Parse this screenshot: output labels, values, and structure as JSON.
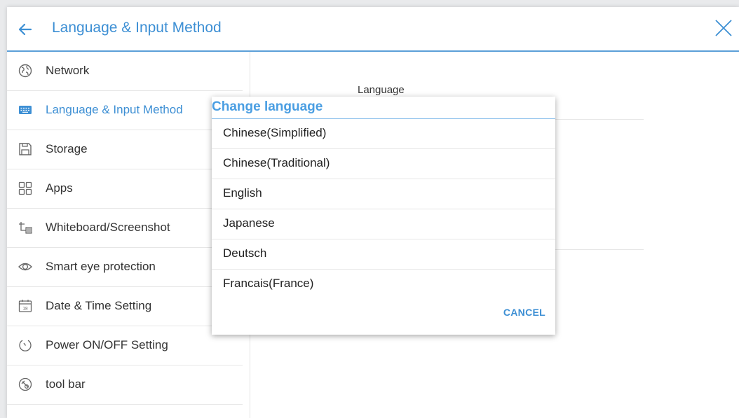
{
  "header": {
    "title": "Language & Input Method"
  },
  "sidebar": {
    "items": [
      {
        "label": "Network",
        "icon": "globe-icon"
      },
      {
        "label": "Language & Input Method",
        "icon": "keyboard-icon",
        "active": true
      },
      {
        "label": "Storage",
        "icon": "storage-icon"
      },
      {
        "label": "Apps",
        "icon": "apps-grid-icon"
      },
      {
        "label": "Whiteboard/Screenshot",
        "icon": "whiteboard-icon"
      },
      {
        "label": "Smart eye protection",
        "icon": "eye-icon"
      },
      {
        "label": "Date & Time Setting",
        "icon": "calendar-icon"
      },
      {
        "label": "Power ON/OFF Setting",
        "icon": "power-timer-icon"
      },
      {
        "label": "tool bar",
        "icon": "toolbar-icon"
      }
    ]
  },
  "content": {
    "language_label": "Language"
  },
  "dialog": {
    "title": "Change language",
    "options": [
      "Chinese(Simplified)",
      "Chinese(Traditional)",
      "English",
      "Japanese",
      "Deutsch",
      "Francais(France)"
    ],
    "cancel_label": "CANCEL"
  },
  "colors": {
    "accent": "#3d8fd4",
    "divider": "#e6e6e6"
  }
}
